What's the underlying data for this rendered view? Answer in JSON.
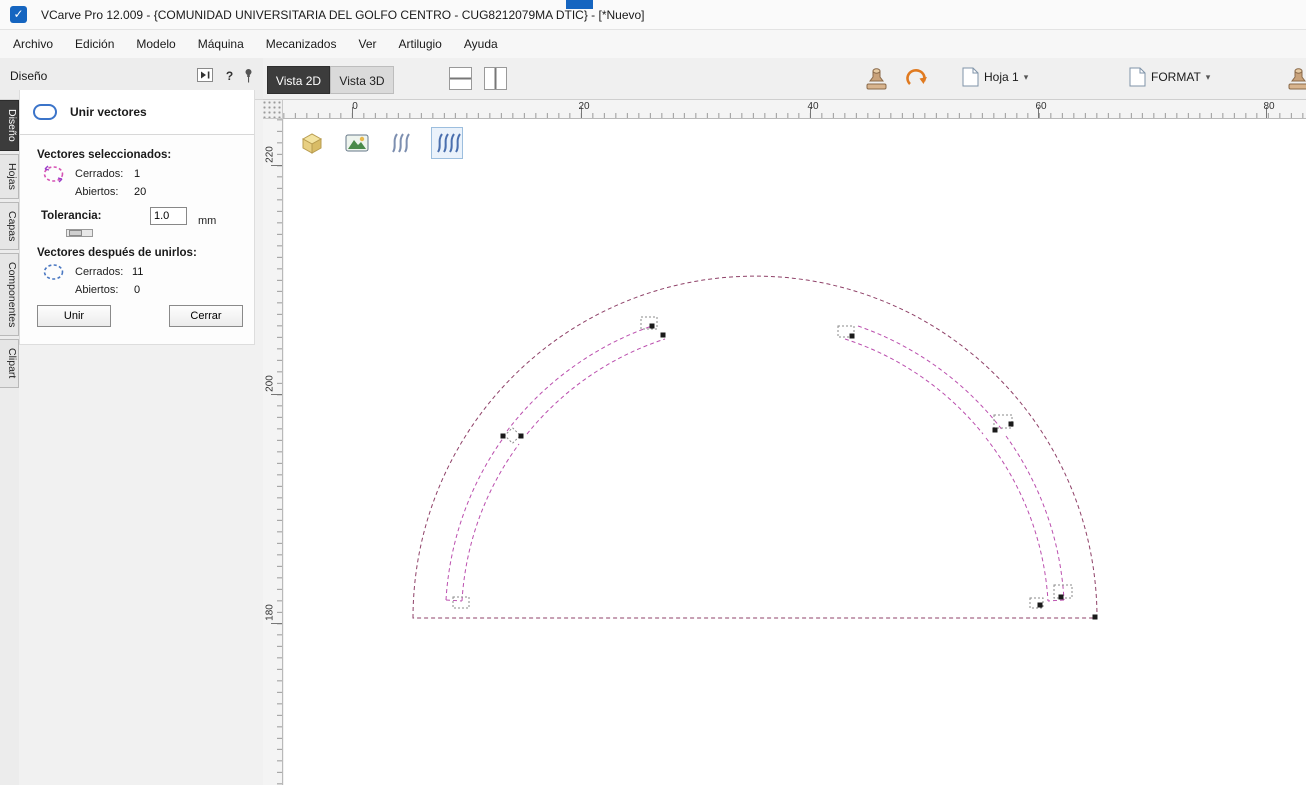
{
  "window": {
    "title": "VCarve Pro 12.009 - {COMUNIDAD UNIVERSITARIA DEL GOLFO CENTRO - CUG8212079MA DTIC} - [*Nuevo]"
  },
  "menu": {
    "items": [
      "Archivo",
      "Edición",
      "Modelo",
      "Máquina",
      "Mecanizados",
      "Ver",
      "Artilugio",
      "Ayuda"
    ]
  },
  "left_panel": {
    "header": "Diseño",
    "tabs": [
      "Diseño",
      "Hojas",
      "Capas",
      "Componentes",
      "Clipart"
    ],
    "tool": {
      "title": "Unir vectores",
      "selected_heading": "Vectores seleccionados:",
      "closed_label": "Cerrados:",
      "open_label": "Abiertos:",
      "selected_closed": "1",
      "selected_open": "20",
      "tolerance_label": "Tolerancia:",
      "tolerance_value": "1.0",
      "tolerance_unit": "mm",
      "after_heading": "Vectores después de unirlos:",
      "after_closed": "11",
      "after_open": "0",
      "join_button": "Unir",
      "close_button": "Cerrar"
    }
  },
  "view_tabs": {
    "tab_2d": "Vista 2D",
    "tab_3d": "Vista 3D"
  },
  "toolbar": {
    "sheet_dropdown": "Hoja 1",
    "format_dropdown": "FORMAT"
  },
  "rulers": {
    "horizontal": [
      "0",
      "20",
      "40",
      "60",
      "80"
    ],
    "vertical": [
      "220",
      "200",
      "180"
    ]
  },
  "icons": {
    "help": "?",
    "caret_down": "▾",
    "app_logo_check": "✓"
  },
  "colors": {
    "app-blue": "#1565c0",
    "active-tab-bg": "#3c3c3c",
    "vector-dark": "#8f4168",
    "vector-pink": "#bb4fae",
    "marker": "#1a1a1a",
    "selection-gray": "#8a8a8a"
  }
}
